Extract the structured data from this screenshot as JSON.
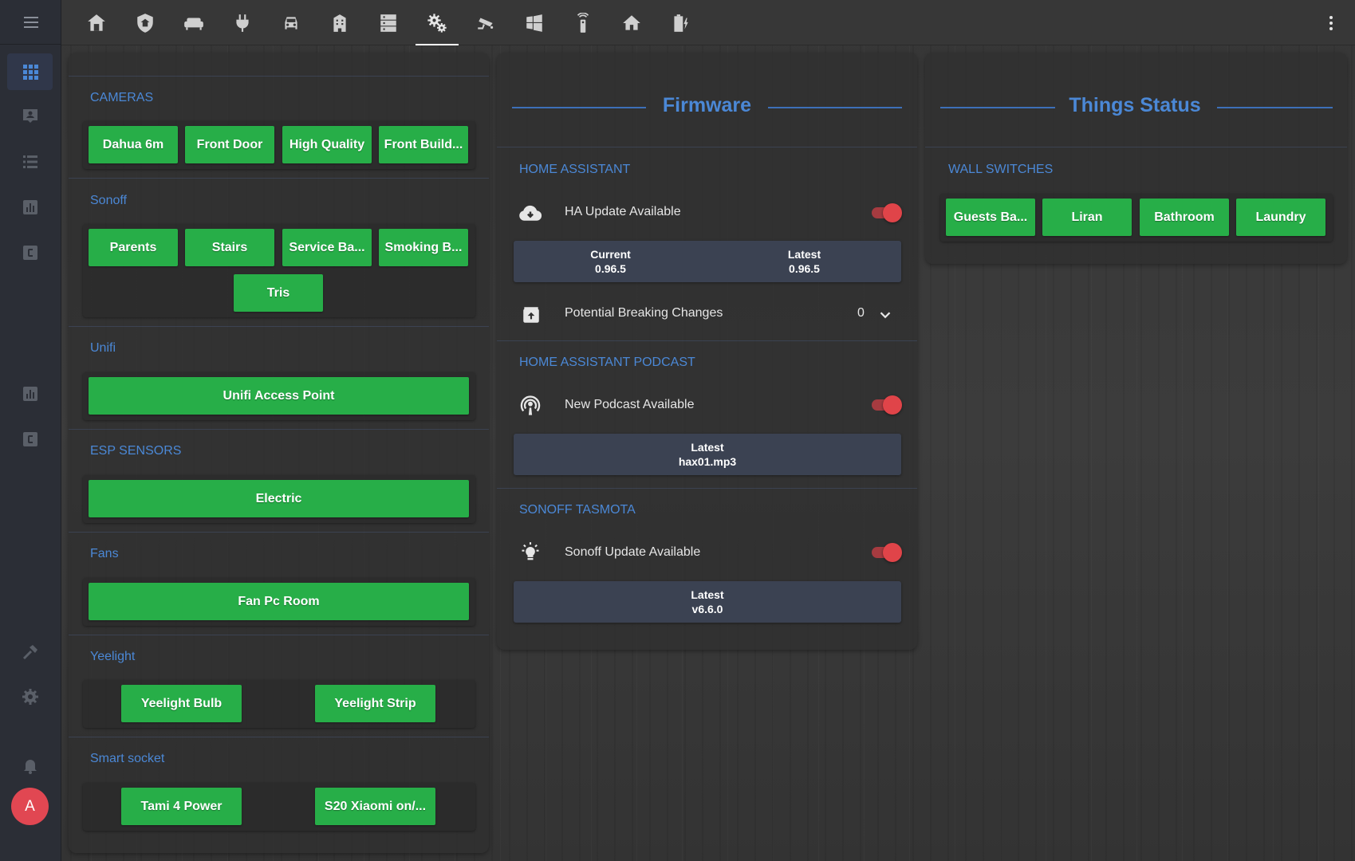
{
  "avatar": {
    "initial": "A"
  },
  "tabs": [
    "home-group",
    "shield",
    "sofa",
    "plug",
    "car",
    "building",
    "server",
    "cogs",
    "cctv",
    "windows",
    "remote",
    "home",
    "battery-charging"
  ],
  "left_card": {
    "sections": [
      {
        "title": "CAMERAS",
        "buttons": [
          "Dahua 6m",
          "Front Door",
          "High Quality",
          "Front Build..."
        ]
      },
      {
        "title": "Sonoff",
        "buttons": [
          "Parents",
          "Stairs",
          "Service Ba...",
          "Smoking B...",
          "Tris"
        ]
      },
      {
        "title": "Unifi",
        "buttons": [
          "Unifi Access Point"
        ]
      },
      {
        "title": "ESP SENSORS",
        "buttons": [
          "Electric"
        ]
      },
      {
        "title": "Fans",
        "buttons": [
          "Fan Pc Room"
        ]
      },
      {
        "title": "Yeelight",
        "buttons": [
          "Yeelight Bulb",
          "Yeelight Strip"
        ]
      },
      {
        "title": "Smart socket",
        "buttons": [
          "Tami 4 Power",
          "S20 Xiaomi on/..."
        ]
      }
    ]
  },
  "firmware": {
    "title": "Firmware",
    "ha": {
      "section": "HOME ASSISTANT",
      "update_label": "HA Update Available",
      "update_on": true,
      "current_label": "Current",
      "current_value": "0.96.5",
      "latest_label": "Latest",
      "latest_value": "0.96.5",
      "breaking_label": "Potential Breaking Changes",
      "breaking_count": "0"
    },
    "podcast": {
      "section": "HOME ASSISTANT PODCAST",
      "update_label": "New Podcast Available",
      "update_on": true,
      "latest_label": "Latest",
      "latest_value": "hax01.mp3"
    },
    "tasmota": {
      "section": "SONOFF TASMOTA",
      "update_label": "Sonoff Update Available",
      "update_on": true,
      "latest_label": "Latest",
      "latest_value": "v6.6.0"
    }
  },
  "things": {
    "title": "Things Status",
    "section": "WALL SWITCHES",
    "buttons": [
      "Guests Ba...",
      "Liran",
      "Bathroom",
      "Laundry"
    ]
  },
  "colors": {
    "accent": "#4b88d6",
    "button_green": "#27ae48",
    "toggle_red": "#e04449"
  }
}
